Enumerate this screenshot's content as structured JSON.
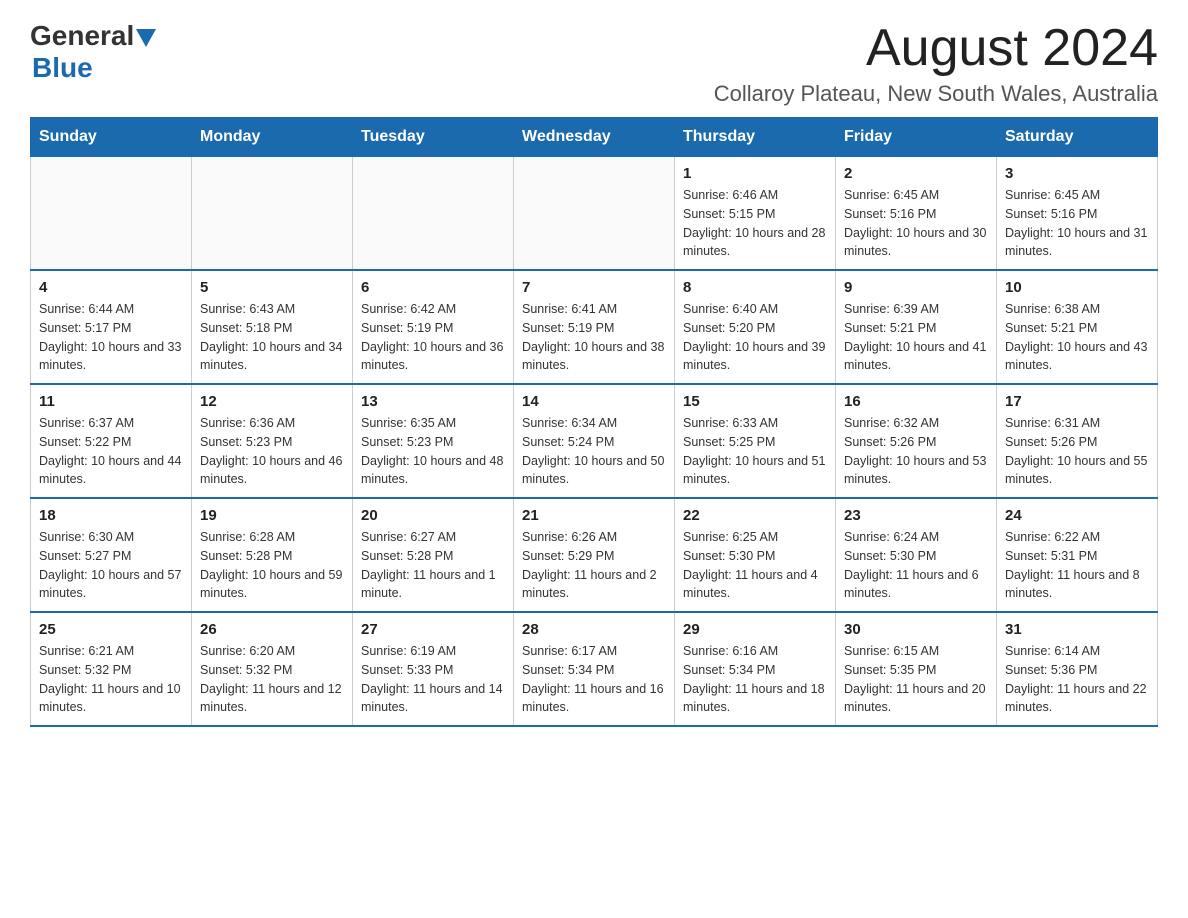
{
  "logo": {
    "general": "General",
    "blue": "Blue"
  },
  "header": {
    "month": "August 2024",
    "location": "Collaroy Plateau, New South Wales, Australia"
  },
  "weekdays": [
    "Sunday",
    "Monday",
    "Tuesday",
    "Wednesday",
    "Thursday",
    "Friday",
    "Saturday"
  ],
  "weeks": [
    [
      {
        "day": "",
        "info": ""
      },
      {
        "day": "",
        "info": ""
      },
      {
        "day": "",
        "info": ""
      },
      {
        "day": "",
        "info": ""
      },
      {
        "day": "1",
        "info": "Sunrise: 6:46 AM\nSunset: 5:15 PM\nDaylight: 10 hours and 28 minutes."
      },
      {
        "day": "2",
        "info": "Sunrise: 6:45 AM\nSunset: 5:16 PM\nDaylight: 10 hours and 30 minutes."
      },
      {
        "day": "3",
        "info": "Sunrise: 6:45 AM\nSunset: 5:16 PM\nDaylight: 10 hours and 31 minutes."
      }
    ],
    [
      {
        "day": "4",
        "info": "Sunrise: 6:44 AM\nSunset: 5:17 PM\nDaylight: 10 hours and 33 minutes."
      },
      {
        "day": "5",
        "info": "Sunrise: 6:43 AM\nSunset: 5:18 PM\nDaylight: 10 hours and 34 minutes."
      },
      {
        "day": "6",
        "info": "Sunrise: 6:42 AM\nSunset: 5:19 PM\nDaylight: 10 hours and 36 minutes."
      },
      {
        "day": "7",
        "info": "Sunrise: 6:41 AM\nSunset: 5:19 PM\nDaylight: 10 hours and 38 minutes."
      },
      {
        "day": "8",
        "info": "Sunrise: 6:40 AM\nSunset: 5:20 PM\nDaylight: 10 hours and 39 minutes."
      },
      {
        "day": "9",
        "info": "Sunrise: 6:39 AM\nSunset: 5:21 PM\nDaylight: 10 hours and 41 minutes."
      },
      {
        "day": "10",
        "info": "Sunrise: 6:38 AM\nSunset: 5:21 PM\nDaylight: 10 hours and 43 minutes."
      }
    ],
    [
      {
        "day": "11",
        "info": "Sunrise: 6:37 AM\nSunset: 5:22 PM\nDaylight: 10 hours and 44 minutes."
      },
      {
        "day": "12",
        "info": "Sunrise: 6:36 AM\nSunset: 5:23 PM\nDaylight: 10 hours and 46 minutes."
      },
      {
        "day": "13",
        "info": "Sunrise: 6:35 AM\nSunset: 5:23 PM\nDaylight: 10 hours and 48 minutes."
      },
      {
        "day": "14",
        "info": "Sunrise: 6:34 AM\nSunset: 5:24 PM\nDaylight: 10 hours and 50 minutes."
      },
      {
        "day": "15",
        "info": "Sunrise: 6:33 AM\nSunset: 5:25 PM\nDaylight: 10 hours and 51 minutes."
      },
      {
        "day": "16",
        "info": "Sunrise: 6:32 AM\nSunset: 5:26 PM\nDaylight: 10 hours and 53 minutes."
      },
      {
        "day": "17",
        "info": "Sunrise: 6:31 AM\nSunset: 5:26 PM\nDaylight: 10 hours and 55 minutes."
      }
    ],
    [
      {
        "day": "18",
        "info": "Sunrise: 6:30 AM\nSunset: 5:27 PM\nDaylight: 10 hours and 57 minutes."
      },
      {
        "day": "19",
        "info": "Sunrise: 6:28 AM\nSunset: 5:28 PM\nDaylight: 10 hours and 59 minutes."
      },
      {
        "day": "20",
        "info": "Sunrise: 6:27 AM\nSunset: 5:28 PM\nDaylight: 11 hours and 1 minute."
      },
      {
        "day": "21",
        "info": "Sunrise: 6:26 AM\nSunset: 5:29 PM\nDaylight: 11 hours and 2 minutes."
      },
      {
        "day": "22",
        "info": "Sunrise: 6:25 AM\nSunset: 5:30 PM\nDaylight: 11 hours and 4 minutes."
      },
      {
        "day": "23",
        "info": "Sunrise: 6:24 AM\nSunset: 5:30 PM\nDaylight: 11 hours and 6 minutes."
      },
      {
        "day": "24",
        "info": "Sunrise: 6:22 AM\nSunset: 5:31 PM\nDaylight: 11 hours and 8 minutes."
      }
    ],
    [
      {
        "day": "25",
        "info": "Sunrise: 6:21 AM\nSunset: 5:32 PM\nDaylight: 11 hours and 10 minutes."
      },
      {
        "day": "26",
        "info": "Sunrise: 6:20 AM\nSunset: 5:32 PM\nDaylight: 11 hours and 12 minutes."
      },
      {
        "day": "27",
        "info": "Sunrise: 6:19 AM\nSunset: 5:33 PM\nDaylight: 11 hours and 14 minutes."
      },
      {
        "day": "28",
        "info": "Sunrise: 6:17 AM\nSunset: 5:34 PM\nDaylight: 11 hours and 16 minutes."
      },
      {
        "day": "29",
        "info": "Sunrise: 6:16 AM\nSunset: 5:34 PM\nDaylight: 11 hours and 18 minutes."
      },
      {
        "day": "30",
        "info": "Sunrise: 6:15 AM\nSunset: 5:35 PM\nDaylight: 11 hours and 20 minutes."
      },
      {
        "day": "31",
        "info": "Sunrise: 6:14 AM\nSunset: 5:36 PM\nDaylight: 11 hours and 22 minutes."
      }
    ]
  ]
}
